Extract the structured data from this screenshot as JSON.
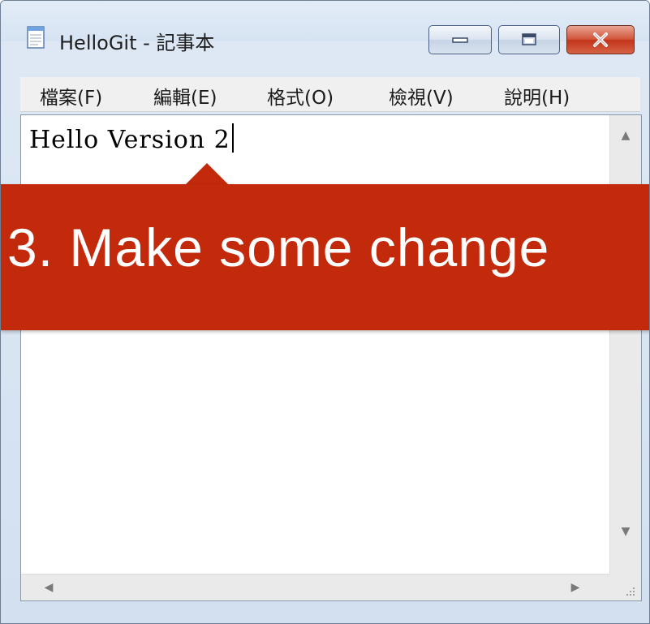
{
  "window": {
    "title": "HelloGit - 記事本",
    "icon": "notepad-icon"
  },
  "controls": {
    "minimize_icon": "minimize-icon",
    "maximize_icon": "maximize-icon",
    "close_icon": "close-icon",
    "close_color": "#c3290b"
  },
  "menu": {
    "items": [
      {
        "label": "檔案(F)"
      },
      {
        "label": "編輯(E)"
      },
      {
        "label": "格式(O)"
      },
      {
        "label": "檢視(V)"
      },
      {
        "label": "說明(H)"
      }
    ]
  },
  "editor": {
    "text": "Hello Version 2"
  },
  "callout": {
    "text": "3. Make some change",
    "color": "#c3290b"
  }
}
